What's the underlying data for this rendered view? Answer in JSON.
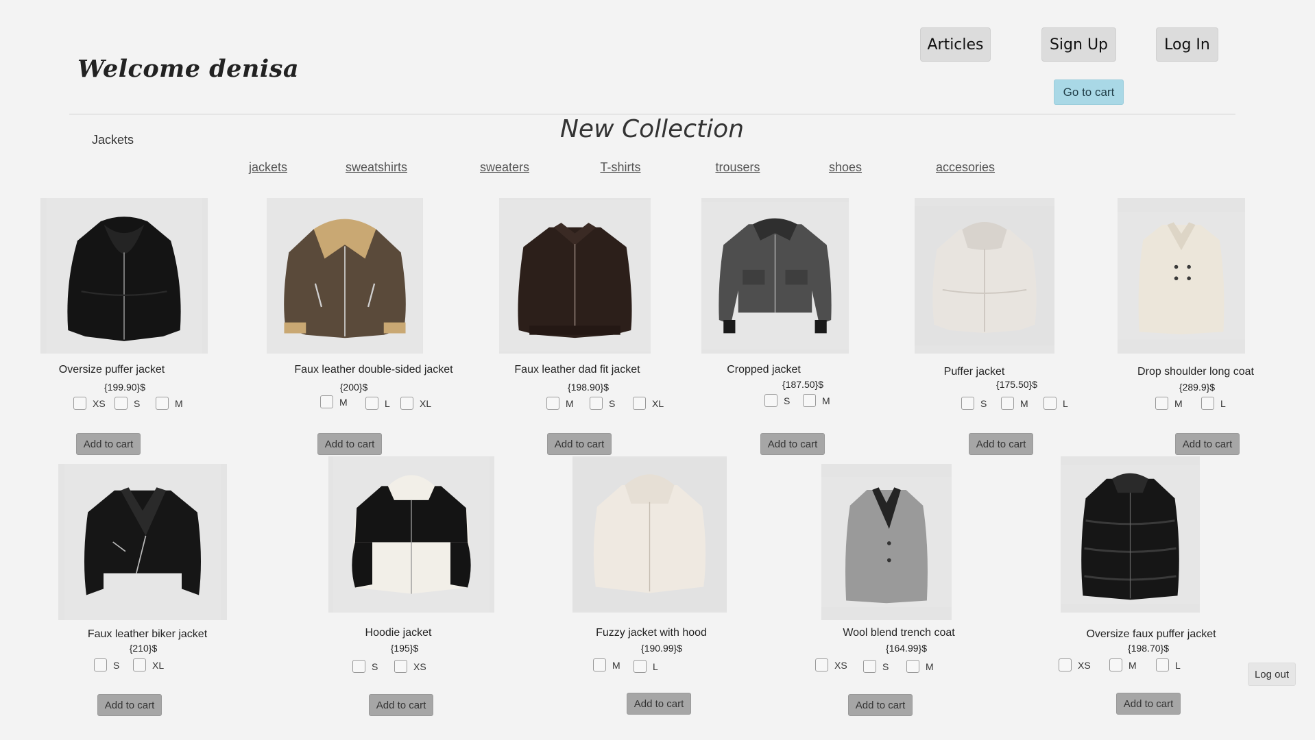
{
  "header": {
    "welcome": "Welcome denisa",
    "nav": {
      "articles": "Articles",
      "sign_up": "Sign Up",
      "log_in": "Log In"
    },
    "go_to_cart": "Go to cart"
  },
  "section_label": "Jackets",
  "collection_title": "New Collection",
  "categories": [
    "jackets",
    "sweatshirts",
    "sweaters",
    "T-shirts",
    "trousers",
    "shoes",
    "accesories"
  ],
  "add_to_cart_label": "Add to cart",
  "logout_label": "Log out",
  "products": [
    {
      "name": "Oversize puffer jacket",
      "price": "{199.90}$",
      "sizes": [
        "XS",
        "S",
        "M"
      ],
      "icon": "puffer-jacket-black"
    },
    {
      "name": "Faux leather double-sided jacket",
      "price": "{200}$",
      "sizes": [
        "M",
        "L",
        "XL"
      ],
      "icon": "shearling-jacket-brown"
    },
    {
      "name": "Faux leather dad fit jacket",
      "price": "{198.90}$",
      "sizes": [
        "M",
        "S",
        "XL"
      ],
      "icon": "leather-jacket-dark-brown"
    },
    {
      "name": "Cropped jacket",
      "price": "{187.50}$",
      "sizes": [
        "S",
        "M"
      ],
      "icon": "cropped-jacket-grey-tweed"
    },
    {
      "name": "Puffer jacket",
      "price": "{175.50}$",
      "sizes": [
        "S",
        "M",
        "L"
      ],
      "icon": "puffer-jacket-white"
    },
    {
      "name": "Drop shoulder long coat",
      "price": "{289.9}$",
      "sizes": [
        "M",
        "L"
      ],
      "icon": "long-coat-cream"
    },
    {
      "name": "Faux leather biker jacket",
      "price": "{210}$",
      "sizes": [
        "S",
        "XL"
      ],
      "icon": "biker-jacket-black"
    },
    {
      "name": "Hoodie jacket",
      "price": "{195}$",
      "sizes": [
        "S",
        "XS"
      ],
      "icon": "hoodie-puffer-black-white"
    },
    {
      "name": "Fuzzy jacket with hood",
      "price": "{190.99}$",
      "sizes": [
        "M",
        "L"
      ],
      "icon": "fuzzy-hooded-jacket-cream"
    },
    {
      "name": "Wool blend trench coat",
      "price": "{164.99}$",
      "sizes": [
        "XS",
        "S",
        "M"
      ],
      "icon": "trench-coat-grey"
    },
    {
      "name": "Oversize faux puffer jacket",
      "price": "{198.70}$",
      "sizes": [
        "XS",
        "M",
        "L"
      ],
      "icon": "long-puffer-black"
    }
  ],
  "colors": {
    "background": "#f3f3f3",
    "nav_button": "#dcdcdc",
    "cart_button": "#a9d8e6",
    "add_button": "#a6a6a6"
  }
}
